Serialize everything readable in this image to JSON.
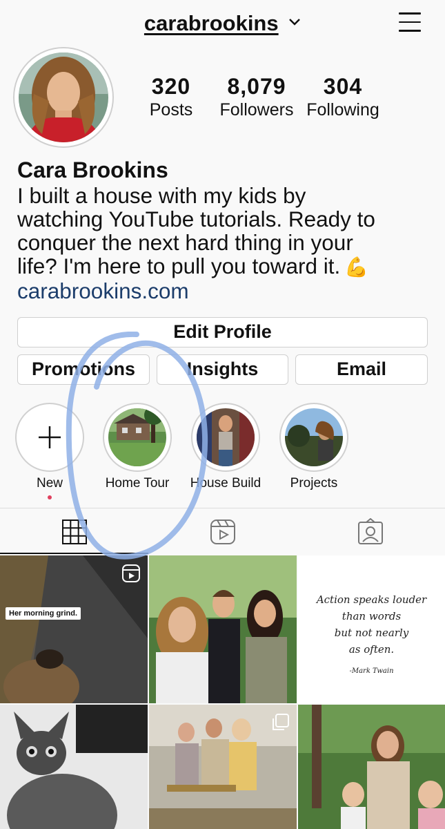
{
  "header": {
    "username": "carabrookins"
  },
  "profile": {
    "stats": [
      {
        "value": "320",
        "label": "Posts"
      },
      {
        "value": "8,079",
        "label": "Followers"
      },
      {
        "value": "304",
        "label": "Following"
      }
    ],
    "name": "Cara Brookins",
    "bio_lines": [
      "I built a house with my kids by",
      "watching YouTube tutorials. Ready to",
      "conquer the next hard thing in your",
      "life? I'm here to pull you toward it."
    ],
    "bio_emoji": "💪",
    "website": "carabrookins.com"
  },
  "actions": {
    "edit_profile": "Edit Profile",
    "promotions": "Promotions",
    "insights": "Insights",
    "email": "Email"
  },
  "highlights": [
    {
      "label": "New"
    },
    {
      "label": "Home Tour"
    },
    {
      "label": "House Build"
    },
    {
      "label": "Projects"
    }
  ],
  "tabs": {
    "grid_icon": "grid-icon",
    "reels_icon": "reels-icon",
    "tagged_icon": "tagged-icon"
  },
  "posts": {
    "p1_caption": "Her morning grind.",
    "p3_quote_lines": [
      "Action speaks louder",
      "than words",
      "but not nearly",
      "as often."
    ],
    "p3_quote_author": "-Mark Twain"
  },
  "colors": {
    "link": "#1c3d6b",
    "new_dot": "#e0405e",
    "scribble": "#8fb0e6"
  }
}
